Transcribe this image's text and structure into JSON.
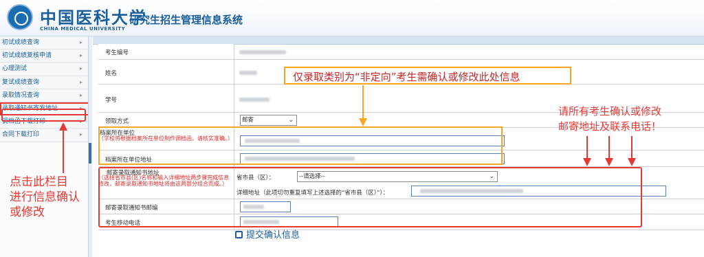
{
  "header": {
    "logo_cn": "中国医科大学",
    "logo_en": "CHINA MEDICAL UNIVERSITY",
    "system_title": "研究生招生管理信息系统"
  },
  "sidebar": {
    "items": [
      {
        "label": "初试成绩查询"
      },
      {
        "label": "初试成绩复核申请"
      },
      {
        "label": "心理测试"
      },
      {
        "label": "复试成绩查询"
      },
      {
        "label": "录取情况查询"
      },
      {
        "label": "录取通知书寄发地址"
      },
      {
        "label": "调档函下载打印"
      },
      {
        "label": "合同下载打印"
      }
    ],
    "arrow": "▸"
  },
  "form": {
    "exam_no_label": "考生编号",
    "name_label": "姓名",
    "student_no_label": "学号",
    "pickup_label": "领取方式",
    "pickup_value": "邮寄",
    "archive_unit_label": "档案所在单位",
    "archive_unit_hint": "（学校将根据档案所在单位制作调档函，请核实准确。）",
    "archive_addr_label": "档案所在单位地址",
    "mail_addr_label": "邮寄录取通知书地址",
    "mail_addr_hint": "（选择省市县(区)名称和输入详细地址两步骤完成信息修改，邮寄录取通知书地址将由这两部分组合而成。）",
    "province_label": "省市县（区）：",
    "province_value": "--请选择--",
    "detail_label": "详细地址（此项切勿重复填写上述选择的“省市县（区）”）：",
    "postcode_label": "邮寄录取通知书邮编",
    "mobile_label": "考生移动电话",
    "submit_label": "提交确认信息"
  },
  "annotations": {
    "top_note": "仅录取类别为“非定向”考生需确认或修改此处信息",
    "right_note": "请所有考生确认或修改\n邮寄地址及联系电话！",
    "left_note": "点击此栏目\n进行信息确认\n或修改"
  },
  "colors": {
    "accent_blue": "#1b5e9c",
    "annotation_orange": "#f5a623",
    "annotation_red": "#e53935"
  }
}
